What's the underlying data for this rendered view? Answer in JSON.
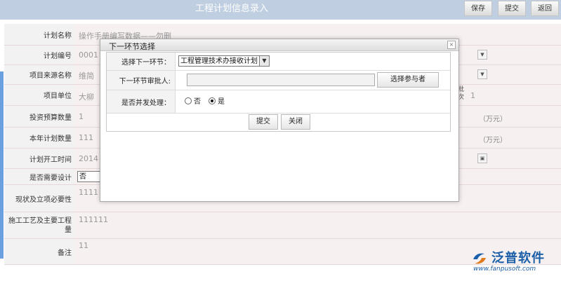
{
  "header": {
    "title": "工程计划信息录入",
    "buttons": [
      "保存",
      "提交",
      "返回"
    ]
  },
  "form": {
    "rows": [
      {
        "label": "计划名称",
        "value": "操作手册编写数据——勿删"
      },
      {
        "label": "计划编号",
        "value": "0001"
      },
      {
        "label": "项目来源名称",
        "value": "维简"
      },
      {
        "label": "项目单位",
        "value": "大柳",
        "side_label": "批次",
        "side_value": "1"
      },
      {
        "label": "投资预算数量",
        "value": "1",
        "unit": "（万元）"
      },
      {
        "label": "本年计划数量",
        "value": "111",
        "unit": "（万元）"
      },
      {
        "label": "计划开工时间",
        "value": "2014"
      },
      {
        "label": "是否需要设计",
        "value": "否"
      },
      {
        "label": "现状及立项必要性",
        "value": "1111"
      },
      {
        "label": "施工工艺及主要工程量",
        "value": "111111"
      },
      {
        "label": "备注",
        "value": "11"
      }
    ]
  },
  "dialog": {
    "title": "下一环节选择",
    "close_glyph": "×",
    "next_step_label": "选择下一环节：",
    "next_step_value": "工程管理技术办接收计划",
    "approver_label": "下一环节审批人:",
    "choose_participant": "选择参与者",
    "parallel_label": "是否并发处理：",
    "option_no": "否",
    "option_yes": "是",
    "parallel_selected": "是",
    "submit": "提交",
    "close": "关闭"
  },
  "brand": {
    "name": "泛普软件",
    "url": "www.fanpusoft.com",
    "color": "#1b5fa8"
  }
}
